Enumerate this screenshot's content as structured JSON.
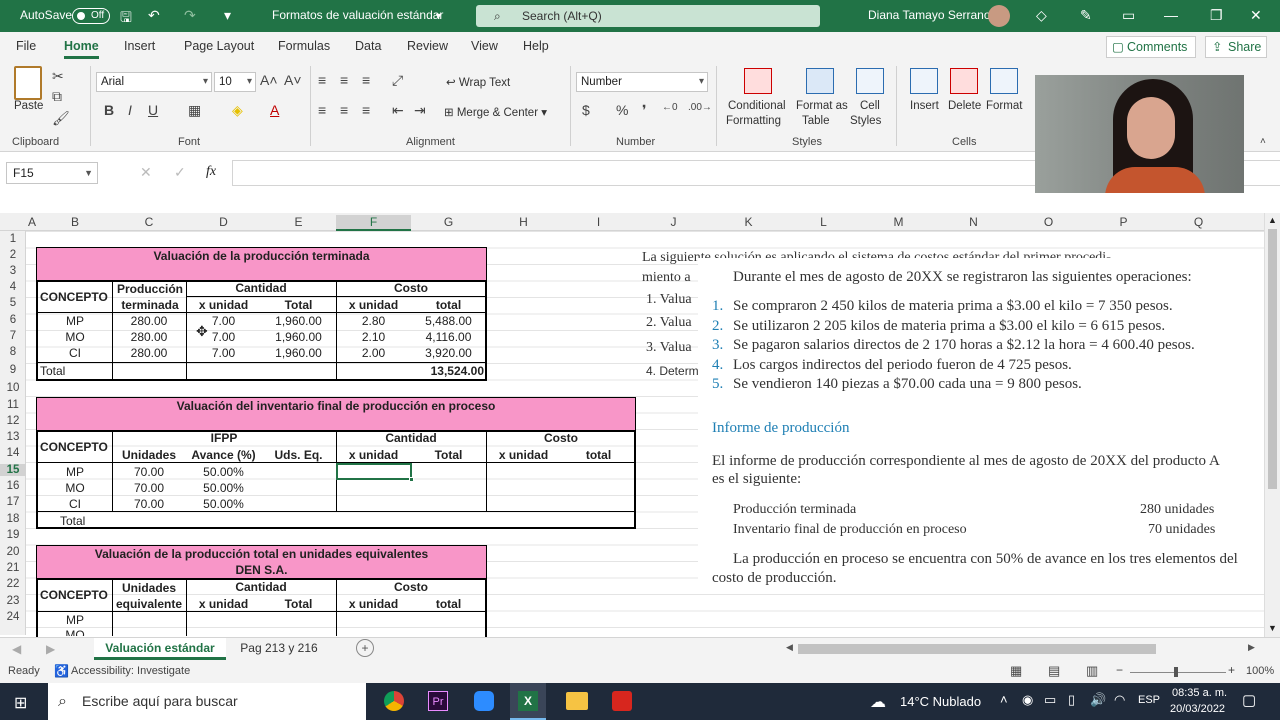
{
  "titlebar": {
    "autosave": "AutoSave",
    "toggle": "Off",
    "doc_title": "Formatos de valuación estándar",
    "search": "Search (Alt+Q)",
    "user": "Diana Tamayo Serrano"
  },
  "menu": {
    "items": [
      "File",
      "Home",
      "Insert",
      "Page Layout",
      "Formulas",
      "Data",
      "Review",
      "View",
      "Help"
    ],
    "comments": "Comments",
    "share": "Share"
  },
  "ribbon": {
    "paste": "Paste",
    "font_name": "Arial",
    "font_size": "10",
    "wrap_text": "Wrap Text",
    "merge_center": "Merge & Center",
    "number_format": "Number",
    "conditional": "Conditional",
    "formatting": "Formatting",
    "format_as": "Format as",
    "table": "Table",
    "cell": "Cell",
    "styles_btn": "Styles",
    "insert": "Insert",
    "delete": "Delete",
    "format": "Format",
    "groups": {
      "clipboard": "Clipboard",
      "font": "Font",
      "alignment": "Alignment",
      "number": "Number",
      "styles": "Styles",
      "cells": "Cells"
    }
  },
  "formula": {
    "name_box": "F15",
    "fx": "fx"
  },
  "columns": [
    "A",
    "B",
    "C",
    "D",
    "E",
    "F",
    "G",
    "H",
    "I",
    "J",
    "K",
    "L",
    "M",
    "N",
    "O",
    "P",
    "Q"
  ],
  "rows": [
    "1",
    "2",
    "3",
    "4",
    "5",
    "6",
    "7",
    "8",
    "9",
    "10",
    "11",
    "12",
    "13",
    "14",
    "15",
    "16",
    "17",
    "18",
    "19",
    "20",
    "21",
    "22",
    "23",
    "24"
  ],
  "t1": {
    "title": "Valuación de la producción terminada",
    "concepto": "CONCEPTO",
    "prod1": "Producción",
    "prod2": "terminada",
    "cantidad": "Cantidad",
    "costo": "Costo",
    "xunidad": "x unidad",
    "total_h": "Total",
    "total_l": "total",
    "rows": [
      [
        "MP",
        "280.00",
        "7.00",
        "1,960.00",
        "2.80",
        "5,488.00"
      ],
      [
        "MO",
        "280.00",
        "7.00",
        "1,960.00",
        "2.10",
        "4,116.00"
      ],
      [
        "CI",
        "280.00",
        "7.00",
        "1,960.00",
        "2.00",
        "3,920.00"
      ]
    ],
    "total": "Total",
    "grand": "13,524.00"
  },
  "t2": {
    "title": "Valuación del inventario final de producción en proceso",
    "concepto": "CONCEPTO",
    "ifpp": "IFPP",
    "unidades": "Unidades",
    "avance": "Avance (%)",
    "udseq": "Uds. Eq.",
    "cantidad": "Cantidad",
    "xunidad": "x unidad",
    "total_h": "Total",
    "costo": "Costo",
    "total_l": "total",
    "rows": [
      [
        "MP",
        "70.00",
        "50.00%"
      ],
      [
        "MO",
        "70.00",
        "50.00%"
      ],
      [
        "CI",
        "70.00",
        "50.00%"
      ]
    ],
    "total": "Total"
  },
  "t3": {
    "title1": "Valuación de la producción total en unidades equivalentes",
    "title2": "DEN S.A.",
    "concepto": "CONCEPTO",
    "unid1": "Unidades",
    "unid2": "equivalente",
    "cantidad": "Cantidad",
    "costo": "Costo",
    "xunidad": "x unidad",
    "total_h": "Total",
    "total_l": "total",
    "mp": "MP",
    "mo": "MO"
  },
  "jtext": {
    "l1": "La siguiente solución es aplicando el sistema de costos estándar del primer procedi-",
    "l2": "miento a",
    "i1": "1.  Valua",
    "i2": "2.  Valua",
    "i3": "3.  Valua",
    "i4": "4.  Determ"
  },
  "image": {
    "intro": "Durante el mes de agosto de 20XX se registraron las siguientes operaciones:",
    "items": [
      [
        "1.",
        "Se compraron 2 450 kilos de materia prima a $3.00 el kilo = 7 350 pesos."
      ],
      [
        "2.",
        "Se utilizaron 2 205 kilos de materia prima a $3.00 el kilo = 6 615 pesos."
      ],
      [
        "3.",
        "Se pagaron salarios directos de 2 170 horas a $2.12 la hora = 4 600.40 pesos."
      ],
      [
        "4.",
        "Los cargos indirectos del periodo fueron de 4 725 pesos."
      ],
      [
        "5.",
        "Se vendieron 140 piezas a $70.00 cada una = 9 800 pesos."
      ]
    ],
    "heading": "Informe de producción",
    "p1a": "El informe de producción correspondiente al mes de agosto de 20XX del producto A",
    "p1b": "es el siguiente:",
    "r1l": "Producción terminada",
    "r1v": "280 unidades",
    "r2l": "Inventario final de producción en proceso",
    "r2v": "70 unidades",
    "p2a": "La producción en proceso se encuentra con 50% de avance en los tres elementos del",
    "p2b": "costo de producción."
  },
  "sheets": {
    "active": "Valuación estándar",
    "other": "Pag 213 y 216"
  },
  "status": {
    "ready": "Ready",
    "access": "Accessibility: Investigate",
    "zoom": "100%"
  },
  "taskbar": {
    "search": "Escribe aquí para buscar",
    "weather": "14°C  Nublado",
    "lang": "ESP",
    "time": "08:35 a. m.",
    "date": "20/03/2022"
  }
}
